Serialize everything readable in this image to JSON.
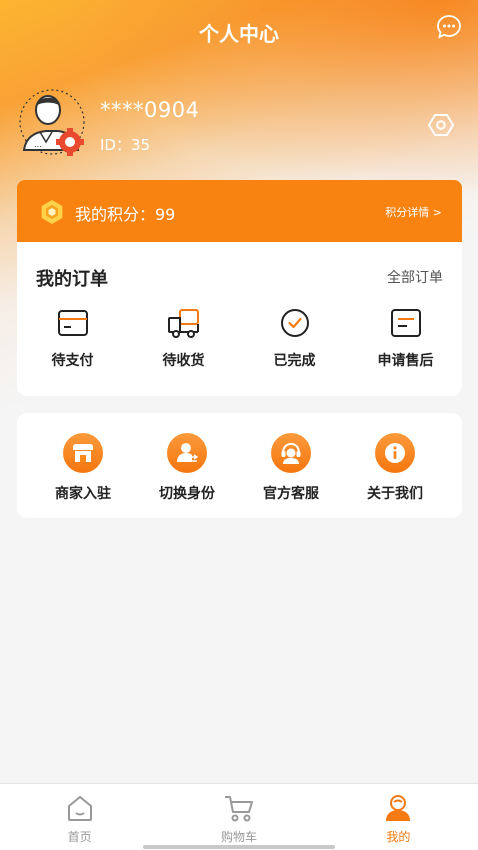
{
  "header": {
    "title": "个人中心",
    "message_icon": "chat-bubble-icon"
  },
  "profile": {
    "username": "****0904",
    "id_text": "ID：35",
    "avatar_icon": "user-gear-avatar",
    "settings_icon": "hexagon-settings-icon"
  },
  "points": {
    "label": "我的积分：99",
    "detail_link": "积分详情 >",
    "icon": "coin-hexagon-icon",
    "color": "#f98310"
  },
  "orders": {
    "title": "我的订单",
    "all_link": "全部订单",
    "items": [
      {
        "label": "待支付",
        "icon": "card-icon"
      },
      {
        "label": "待收货",
        "icon": "delivery-truck-icon"
      },
      {
        "label": "已完成",
        "icon": "check-circle-icon"
      },
      {
        "label": "申请售后",
        "icon": "document-icon"
      }
    ]
  },
  "services": {
    "items": [
      {
        "label": "商家入驻",
        "icon": "shop-icon"
      },
      {
        "label": "切换身份",
        "icon": "switch-user-icon"
      },
      {
        "label": "官方客服",
        "icon": "headset-icon"
      },
      {
        "label": "关于我们",
        "icon": "info-icon"
      }
    ]
  },
  "tabbar": {
    "items": [
      {
        "label": "首页",
        "icon": "home-icon",
        "active": false
      },
      {
        "label": "购物车",
        "icon": "cart-icon",
        "active": false
      },
      {
        "label": "我的",
        "icon": "profile-icon",
        "active": true
      }
    ]
  },
  "colors": {
    "accent": "#f47a11",
    "inactive": "#999999"
  }
}
